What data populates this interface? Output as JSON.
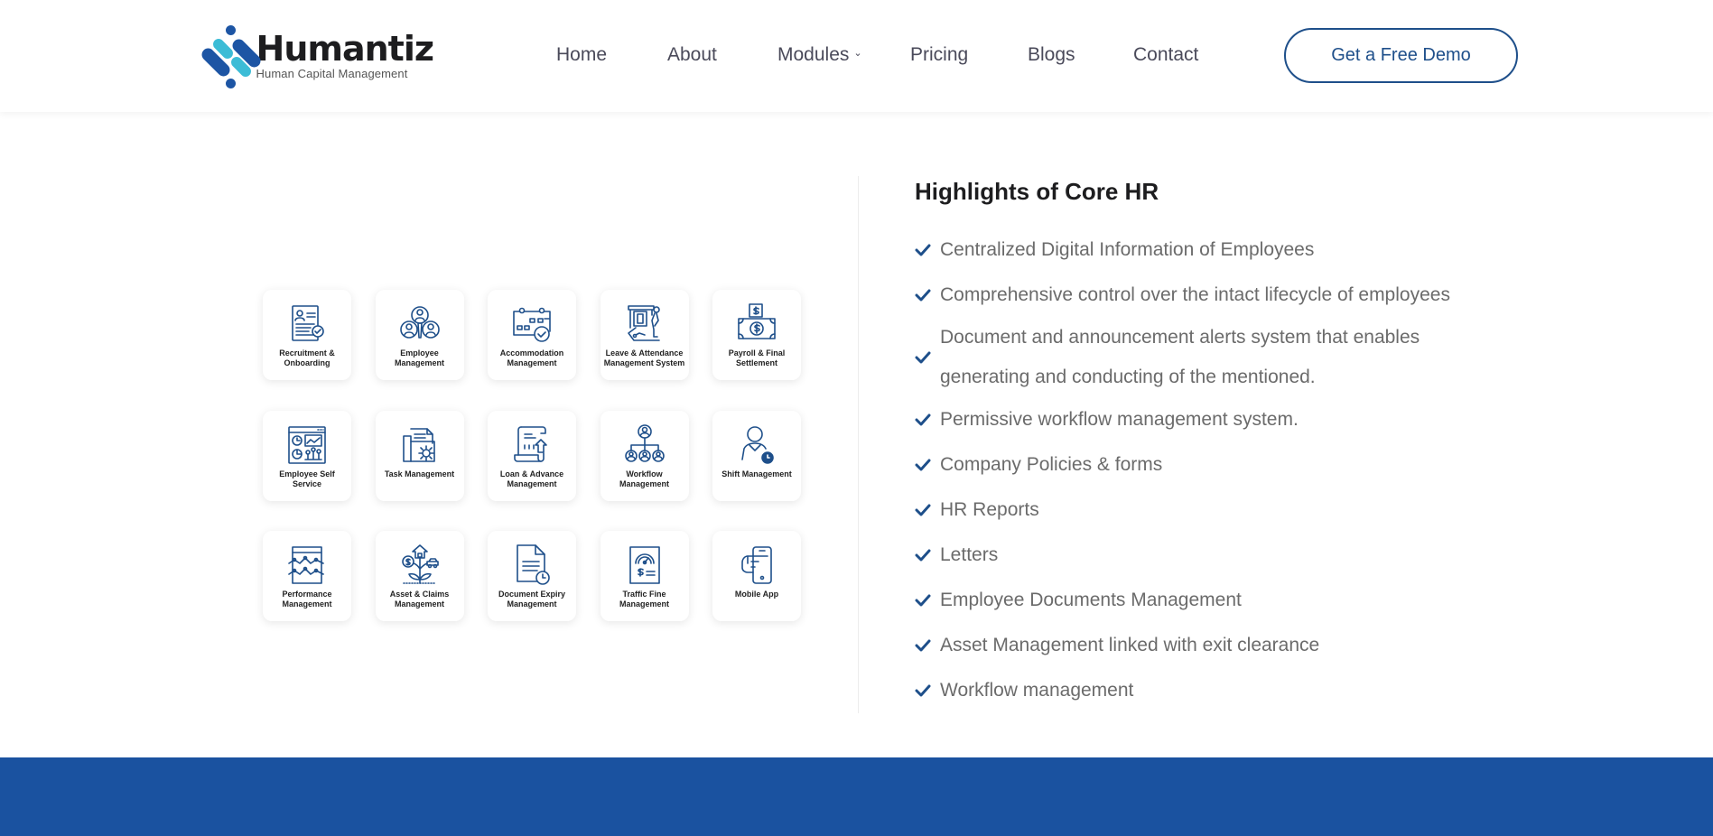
{
  "header": {
    "logo": {
      "name": "Humantiz",
      "tagline": "Human Capital Management"
    },
    "nav": [
      {
        "label": "Home"
      },
      {
        "label": "About"
      },
      {
        "label": "Modules",
        "has_dropdown": true
      },
      {
        "label": "Pricing"
      },
      {
        "label": "Blogs"
      },
      {
        "label": "Contact"
      }
    ],
    "cta_label": "Get a Free Demo"
  },
  "colors": {
    "brand_blue": "#1e4f8a",
    "band_blue": "#1a52a0",
    "logo_dark": "#1d55a4",
    "logo_light": "#3cbcd6",
    "icon_blue": "#1e4f8a"
  },
  "modules": [
    {
      "label": "Recruitment & Onboarding",
      "icon": "resume-check-icon"
    },
    {
      "label": "Employee Management",
      "icon": "team-people-icon"
    },
    {
      "label": "Accommodation Management",
      "icon": "calendar-check-icon"
    },
    {
      "label": "Leave & Attendance Management System",
      "icon": "door-exit-person-icon"
    },
    {
      "label": "Payroll & Final Settlement",
      "icon": "money-bill-icon"
    },
    {
      "label": "Employee Self Service",
      "icon": "dashboard-window-icon"
    },
    {
      "label": "Task Management",
      "icon": "folder-gear-icon"
    },
    {
      "label": "Loan & Advance Management",
      "icon": "receipt-house-icon"
    },
    {
      "label": "Workflow Management",
      "icon": "org-chart-icon"
    },
    {
      "label": "Shift Management",
      "icon": "person-clock-icon"
    },
    {
      "label": "Performance Management",
      "icon": "line-graph-window-icon"
    },
    {
      "label": "Asset & Claims Management",
      "icon": "asset-plant-icon"
    },
    {
      "label": "Document Expiry Management",
      "icon": "document-clock-icon"
    },
    {
      "label": "Traffic Fine Management",
      "icon": "speedometer-fine-icon"
    },
    {
      "label": "Mobile App",
      "icon": "hand-phone-icon"
    }
  ],
  "highlights": {
    "title": "Highlights of Core HR",
    "items": [
      "Centralized Digital Information of Employees",
      "Comprehensive control over the intact lifecycle of employees",
      "Document and announcement alerts system that enables generating and conducting of the mentioned.",
      "Permissive workflow management system.",
      "Company Policies & forms",
      "HR Reports",
      "Letters",
      "Employee Documents Management",
      "Asset Management linked with exit clearance",
      "Workflow management"
    ]
  }
}
